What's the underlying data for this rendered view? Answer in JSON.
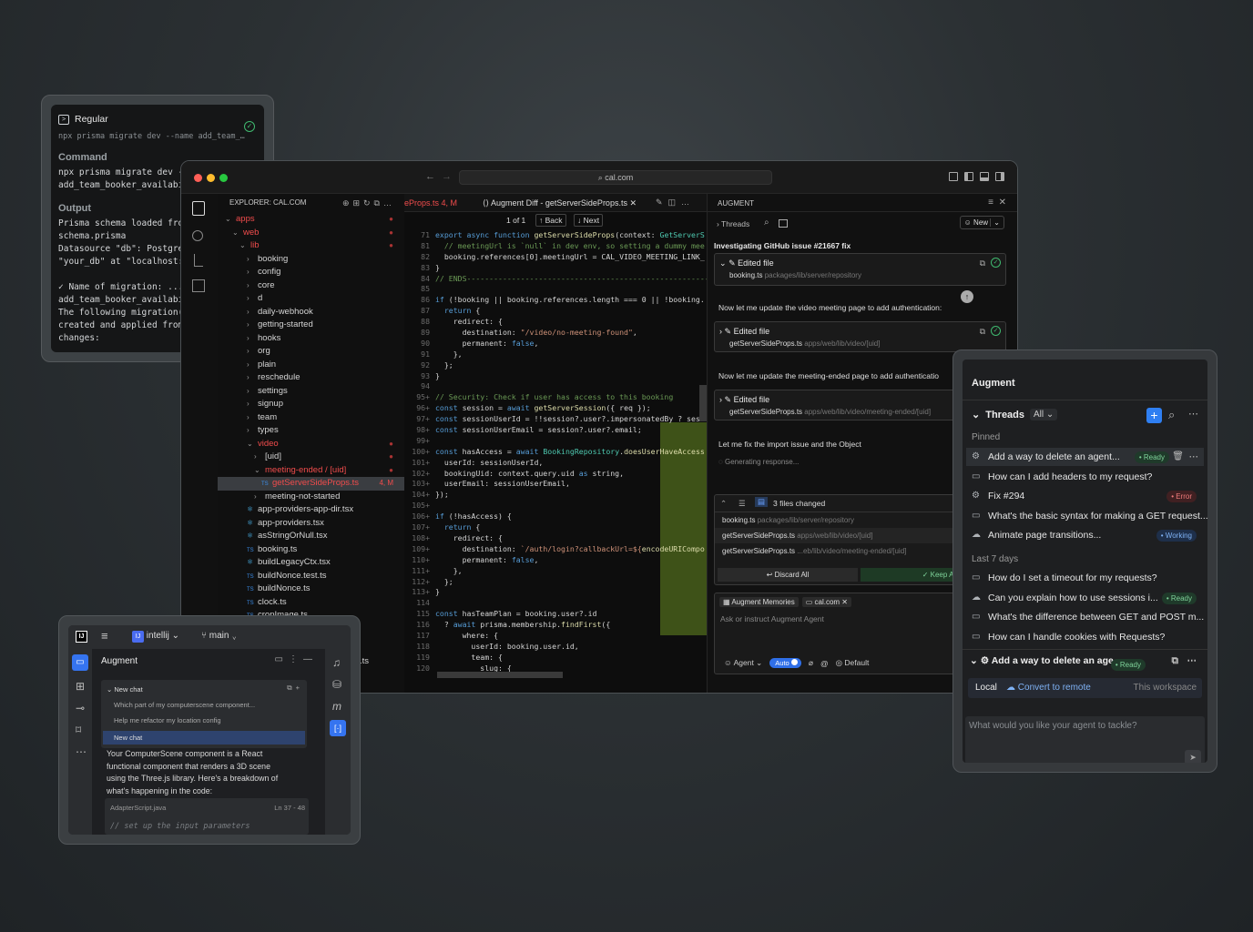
{
  "terminal": {
    "title": "Regular",
    "cmd_line": "npx prisma migrate dev --name add_team_…",
    "command_label": "Command",
    "command_text": "npx prisma migrate dev --\nadd_team_booker_availabi",
    "output_label": "Output",
    "output_text": "Prisma schema loaded from\nschema.prisma\nDatasource \"db\": PostgreS\n\"your_db\" at \"localhost:5\n\n✓ Name of migration: ...\nadd_team_booker_availabi\nThe following migration(s\ncreated and applied from\nchanges:"
  },
  "vscode": {
    "address": "cal.com",
    "explorer_title": "EXPLORER: CAL.COM",
    "tree": [
      {
        "label": "apps",
        "indent": 0,
        "chev": "v",
        "red": true,
        "mark": "●"
      },
      {
        "label": "web",
        "indent": 1,
        "chev": "v",
        "red": true,
        "mark": "●"
      },
      {
        "label": "lib",
        "indent": 2,
        "chev": "v",
        "red": true,
        "mark": "●"
      },
      {
        "label": "booking",
        "indent": 3,
        "chev": ">"
      },
      {
        "label": "config",
        "indent": 3,
        "chev": ">"
      },
      {
        "label": "core",
        "indent": 3,
        "chev": ">"
      },
      {
        "label": "d",
        "indent": 3,
        "chev": ">"
      },
      {
        "label": "daily-webhook",
        "indent": 3,
        "chev": ">"
      },
      {
        "label": "getting-started",
        "indent": 3,
        "chev": ">"
      },
      {
        "label": "hooks",
        "indent": 3,
        "chev": ">"
      },
      {
        "label": "org",
        "indent": 3,
        "chev": ">"
      },
      {
        "label": "plain",
        "indent": 3,
        "chev": ">"
      },
      {
        "label": "reschedule",
        "indent": 3,
        "chev": ">"
      },
      {
        "label": "settings",
        "indent": 3,
        "chev": ">"
      },
      {
        "label": "signup",
        "indent": 3,
        "chev": ">"
      },
      {
        "label": "team",
        "indent": 3,
        "chev": ">"
      },
      {
        "label": "types",
        "indent": 3,
        "chev": ">"
      },
      {
        "label": "video",
        "indent": 3,
        "chev": "v",
        "red": true,
        "mark": "●"
      },
      {
        "label": "[uid]",
        "indent": 4,
        "chev": ">",
        "mark": "●"
      },
      {
        "label": "meeting-ended / [uid]",
        "indent": 4,
        "chev": "v",
        "red": true,
        "mark": "●"
      },
      {
        "label": "getServerSideProps.ts",
        "indent": 5,
        "chev": "TS",
        "red": true,
        "sel": true,
        "mark": "4, M"
      },
      {
        "label": "meeting-not-started",
        "indent": 4,
        "chev": ">"
      },
      {
        "label": "app-providers-app-dir.tsx",
        "indent": 3,
        "chev": "⚛"
      },
      {
        "label": "app-providers.tsx",
        "indent": 3,
        "chev": "⚛"
      },
      {
        "label": "asStringOrNull.tsx",
        "indent": 3,
        "chev": "⚛"
      },
      {
        "label": "booking.ts",
        "indent": 3,
        "chev": "TS"
      },
      {
        "label": "buildLegacyCtx.tsx",
        "indent": 3,
        "chev": "⚛"
      },
      {
        "label": "buildNonce.test.ts",
        "indent": 3,
        "chev": "TS"
      },
      {
        "label": "buildNonce.ts",
        "indent": 3,
        "chev": "TS"
      },
      {
        "label": "clock.ts",
        "indent": 3,
        "chev": "TS"
      },
      {
        "label": "cropImage.ts",
        "indent": 3,
        "chev": "TS"
      }
    ],
    "tab1": "eProps.ts 4, M",
    "tab2": "Augment Diff - getServerSideProps.ts",
    "diff_counter": "1 of 1",
    "back": "Back",
    "next": "Next",
    "code": [
      [
        "71",
        "export async function getServerSideProps(context: GetServerS"
      ],
      [
        "81",
        "  // meetingUrl is `null` in dev env, so setting a dummy mee"
      ],
      [
        "82",
        "  booking.references[0].meetingUrl = CAL_VIDEO_MEETING_LINK_"
      ],
      [
        "83",
        "}"
      ],
      [
        "84",
        "// ENDS----------------------------------------------------------"
      ],
      [
        "85",
        ""
      ],
      [
        "86",
        "if (!booking || booking.references.length === 0 || !booking."
      ],
      [
        "87",
        "  return {"
      ],
      [
        "88",
        "    redirect: {"
      ],
      [
        "89",
        "      destination: \"/video/no-meeting-found\","
      ],
      [
        "90",
        "      permanent: false,"
      ],
      [
        "91",
        "    },"
      ],
      [
        "92",
        "  };"
      ],
      [
        "93",
        "}"
      ],
      [
        "94",
        ""
      ],
      [
        "95+",
        "// Security: Check if user has access to this booking"
      ],
      [
        "96+",
        "const session = await getServerSession({ req });"
      ],
      [
        "97+",
        "const sessionUserId = !!session?.user?.impersonatedBy ? sess"
      ],
      [
        "98+",
        "const sessionUserEmail = session?.user?.email;"
      ],
      [
        "99+",
        ""
      ],
      [
        "100+",
        "const hasAccess = await BookingRepository.doesUserHaveAccess"
      ],
      [
        "101+",
        "  userId: sessionUserId,"
      ],
      [
        "102+",
        "  bookingUid: context.query.uid as string,"
      ],
      [
        "103+",
        "  userEmail: sessionUserEmail,"
      ],
      [
        "104+",
        "});"
      ],
      [
        "105+",
        ""
      ],
      [
        "106+",
        "if (!hasAccess) {"
      ],
      [
        "107+",
        "  return {"
      ],
      [
        "108+",
        "    redirect: {"
      ],
      [
        "109+",
        "      destination: `/auth/login?callbackUrl=${encodeURICompo"
      ],
      [
        "110+",
        "      permanent: false,"
      ],
      [
        "111+",
        "    },"
      ],
      [
        "112+",
        "  };"
      ],
      [
        "113+",
        "}"
      ],
      [
        "114",
        ""
      ],
      [
        "115",
        "const hasTeamPlan = booking.user?.id"
      ],
      [
        "116",
        "  ? await prisma.membership.findFirst({"
      ],
      [
        "117",
        "      where: {"
      ],
      [
        "118",
        "        userId: booking.user.id,"
      ],
      [
        "119",
        "        team: {"
      ],
      [
        "120",
        "          slug: {"
      ]
    ],
    "aug_title": "AUGMENT",
    "threads": "Threads",
    "new": "New",
    "issue": "Investigating GitHub issue #21667 fix",
    "edited": "Edited file",
    "file1": "booking.ts",
    "path1": "packages/lib/server/repository",
    "msg1": "Now let me update the video meeting page to add authentication:",
    "file2": "getServerSideProps.ts",
    "path2": "apps/web/lib/video/[uid]",
    "msg2": "Now let me update the meeting-ended page to add authenticatio",
    "path3": "apps/web/lib/video/meeting-ended/[uid]",
    "msg3": "Let me fix the import issue and the Object",
    "generating": "Generating response...",
    "files_changed": "3 files changed",
    "fc_path3": "...eb/lib/video/meeting-ended/[uid]",
    "discard": "Discard All",
    "keep": "Keep All",
    "memories": "Augment Memories",
    "ctx": "cal.com",
    "ask": "Ask or instruct Augment Agent",
    "agent": "Agent",
    "auto": "Auto",
    "default": "Default",
    "partial_ts": ".ts"
  },
  "right": {
    "title": "Augment",
    "threads": "Threads",
    "filter": "All",
    "pinned": "Pinned",
    "pinned_items": [
      {
        "icon": "⚙",
        "label": "Add a way to delete an agent...",
        "badge": "Ready",
        "type": "ready",
        "hover": true
      },
      {
        "icon": "▭",
        "label": "How can I add headers to my request?"
      },
      {
        "icon": "⚙",
        "label": "Fix #294",
        "badge": "Error",
        "type": "err"
      },
      {
        "icon": "▭",
        "label": "What's the basic syntax for making a GET request..."
      },
      {
        "icon": "☁",
        "label": "Animate page transitions...",
        "badge": "Working",
        "type": "work"
      }
    ],
    "last7": "Last 7 days",
    "recent_items": [
      {
        "icon": "▭",
        "label": "How do I set a timeout for my requests?"
      },
      {
        "icon": "☁",
        "label": "Can you explain how to use sessions i...",
        "badge": "Ready",
        "type": "ready"
      },
      {
        "icon": "▭",
        "label": "What's the difference between GET and POST m..."
      },
      {
        "icon": "▭",
        "label": "How can I handle cookies with Requests?"
      }
    ],
    "active": "Add a way to delete an age...",
    "active_badge": "Ready",
    "local": "Local",
    "convert": "Convert to remote",
    "workspace": "This workspace",
    "placeholder": "What would you like your agent to tackle?"
  },
  "intellij": {
    "project": "intellij",
    "badge": "IJ",
    "branch": "main",
    "title": "Augment",
    "newchat": "New chat",
    "hist1": "Which part of my computerscene component...",
    "hist2": "Help me refactor my location config",
    "hist3": "New chat",
    "msg": "Your ComputerScene component is a React\nfunctional component that renders a 3D scene\nusing the Three.js library. Here's a breakdown of\nwhat's happening in the code:",
    "file": "AdapterScript.java",
    "lines": "Ln 37 - 48",
    "code": "// set up the input parameters"
  }
}
